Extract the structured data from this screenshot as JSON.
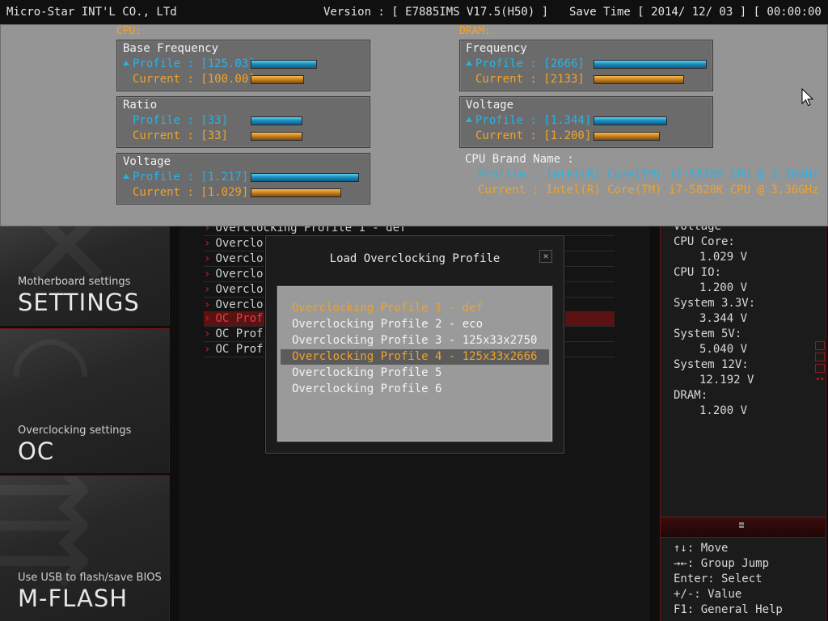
{
  "topbar": {
    "company": "Micro-Star INT'L CO., LTd",
    "version": "Version : [ E7885IMS V17.5(H50) ]",
    "save_time": "Save Time [ 2014/ 12/ 03 ] [ 00:00:00 ]"
  },
  "info": {
    "cpu_label": "CPU:",
    "dram_label": "DRAM:",
    "cpu": {
      "base_frequency": {
        "title": "Base Frequency",
        "profile": "Profile : [125.03]",
        "current": "Current : [100.00]",
        "profile_level": 0.56,
        "current_level": 0.45
      },
      "ratio": {
        "title": "Ratio",
        "profile": "Profile : [33]",
        "current": "Current : [33]",
        "profile_level": 0.44,
        "current_level": 0.44
      },
      "voltage": {
        "title": "Voltage",
        "profile": "Profile : [1.217]",
        "current": "Current : [1.029]",
        "profile_level": 0.92,
        "current_level": 0.77
      }
    },
    "dram": {
      "frequency": {
        "title": "Frequency",
        "profile": "Profile : [2666]",
        "current": "Current : [2133]",
        "profile_level": 0.96,
        "current_level": 0.77
      },
      "voltage": {
        "title": "Voltage",
        "profile": "Profile : [1.344]",
        "current": "Current : [1.200]",
        "profile_level": 0.62,
        "current_level": 0.56
      }
    },
    "cpu_brand": {
      "title": "CPU Brand Name :",
      "profile": "Profile : Intel(R) Core(TM) i7-5820K CPU @ 3.30GHz",
      "current": "Current : Intel(R) Core(TM) i7-5820K CPU @ 3.30GHz"
    },
    "colors": {
      "profile": "#25b4ea",
      "current": "#f0a32a"
    }
  },
  "nav": {
    "settings": {
      "sub": "Motherboard settings",
      "big": "SETTINGS"
    },
    "oc": {
      "sub": "Overclocking settings",
      "big": "OC"
    },
    "mflash": {
      "sub": "Use USB to flash/save BIOS",
      "big": "M-FLASH"
    }
  },
  "center_list": [
    "Overclocking Profile 1 - def",
    "Overcloc",
    "Overcloc",
    "Overcloc",
    "Overcloc",
    "Overcloc",
    "OC Profi",
    "OC Profi",
    "OC Profi"
  ],
  "monitor": {
    "voltage_label": "Voltage",
    "cpu_core_label": "CPU Core:",
    "cpu_core_value": "1.029 V",
    "cpu_io_label": "CPU IO:",
    "cpu_io_value": "1.200 V",
    "sys33_label": "System 3.3V:",
    "sys33_value": "3.344 V",
    "sys5_label": "System 5V:",
    "sys5_value": "5.040 V",
    "sys12_label": "System 12V:",
    "sys12_value": "12.192 V",
    "dram_label": "DRAM:",
    "dram_value": "1.200 V"
  },
  "help": {
    "move": "↑↓: Move",
    "group_jump": "→←: Group Jump",
    "enter": "Enter: Select",
    "value": "+/-: Value",
    "f1": "F1: General Help"
  },
  "modal": {
    "title": "Load Overclocking Profile",
    "close_glyph": "✕",
    "profiles": [
      "Overclocking Profile 1 - def",
      "Overclocking Profile 2 - eco",
      "Overclocking Profile 3 - 125x33x2750",
      "Overclocking Profile 4 - 125x33x2666",
      "Overclocking Profile 5",
      "Overclocking Profile 6"
    ],
    "selected_index": 3
  }
}
